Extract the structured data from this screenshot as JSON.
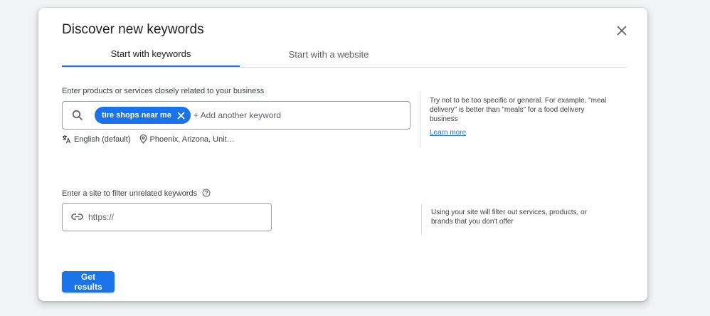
{
  "dialog": {
    "title": "Discover new keywords"
  },
  "tabs": [
    {
      "label": "Start with keywords",
      "active": true
    },
    {
      "label": "Start with a website",
      "active": false
    }
  ],
  "keywords": {
    "label": "Enter products or services closely related to your business",
    "chips": [
      "tire shops near me"
    ],
    "placeholder": "+ Add another keyword",
    "language": "English (default)",
    "location": "Phoenix, Arizona, Unit…",
    "hint": "Try not to be too specific or general. For example, \"meal delivery\" is better than \"meals\" for a food delivery business",
    "learn_more": "Learn more"
  },
  "site": {
    "label": "Enter a site to filter unrelated keywords",
    "placeholder": "https://",
    "hint": "Using your site will filter out services, products, or brands that you don't offer"
  },
  "actions": {
    "get_results": "Get results"
  },
  "colors": {
    "accent": "#1a73e8",
    "border": "#dadce0"
  },
  "icons": {
    "close": "close-icon",
    "search": "search-icon",
    "translate": "translate-icon",
    "location": "location-pin-icon",
    "help": "help-icon",
    "link": "link-icon"
  }
}
